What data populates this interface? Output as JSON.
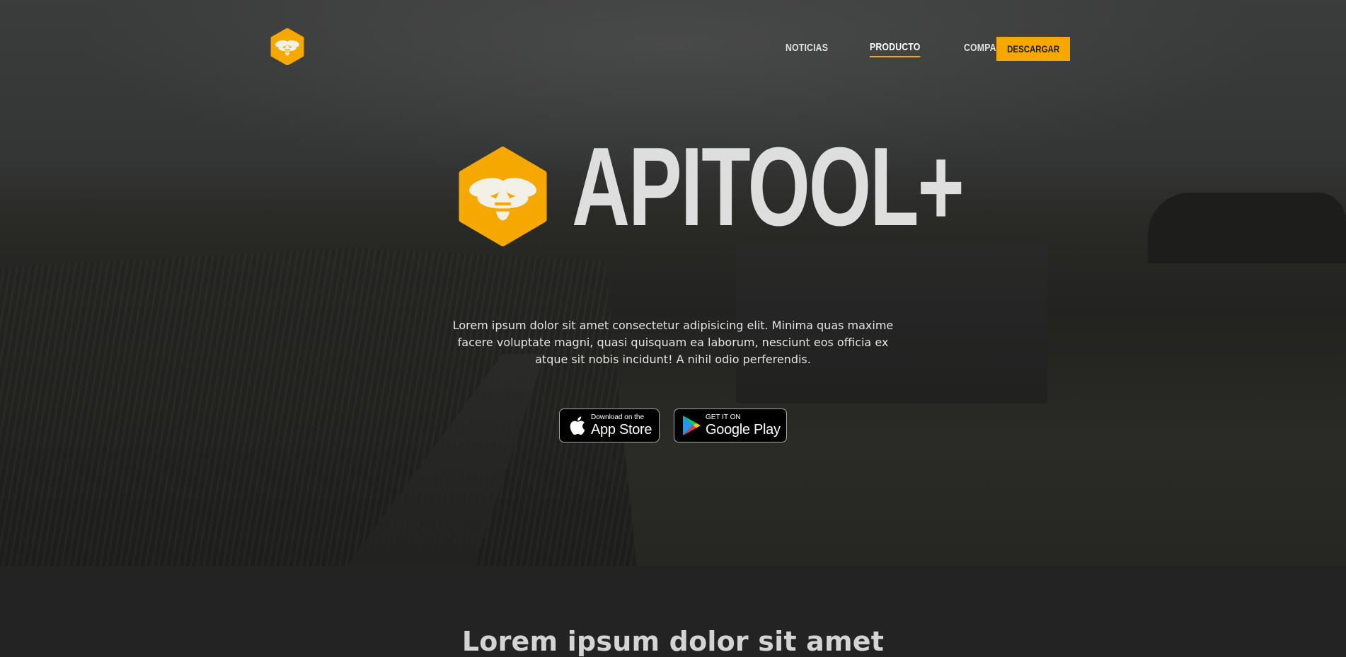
{
  "brand": {
    "name": "APITOOL+",
    "accent_color": "#f5a800",
    "logo_icon": "bee-hexagon-icon"
  },
  "nav": {
    "items": [
      {
        "label": "NOTICIAS",
        "active": false
      },
      {
        "label": "PRODUCTO",
        "active": true
      },
      {
        "label": "COMPAÑÍA",
        "active": false
      }
    ],
    "cta_label": "DESCARGAR"
  },
  "hero": {
    "description": "Lorem ipsum dolor sit amet consectetur adipisicing elit. Minima quas maxime facere voluptate magni, quasi quisquam ea laborum, nesciunt eos officia ex atque sit nobis incidunt! A nihil odio perferendis."
  },
  "stores": {
    "apple": {
      "small": "Download on the",
      "big": "App Store",
      "icon": "apple-icon"
    },
    "google": {
      "small": "GET IT ON",
      "big": "Google Play",
      "icon": "google-play-icon"
    }
  },
  "section": {
    "title": "Lorem ipsum dolor sit amet"
  }
}
